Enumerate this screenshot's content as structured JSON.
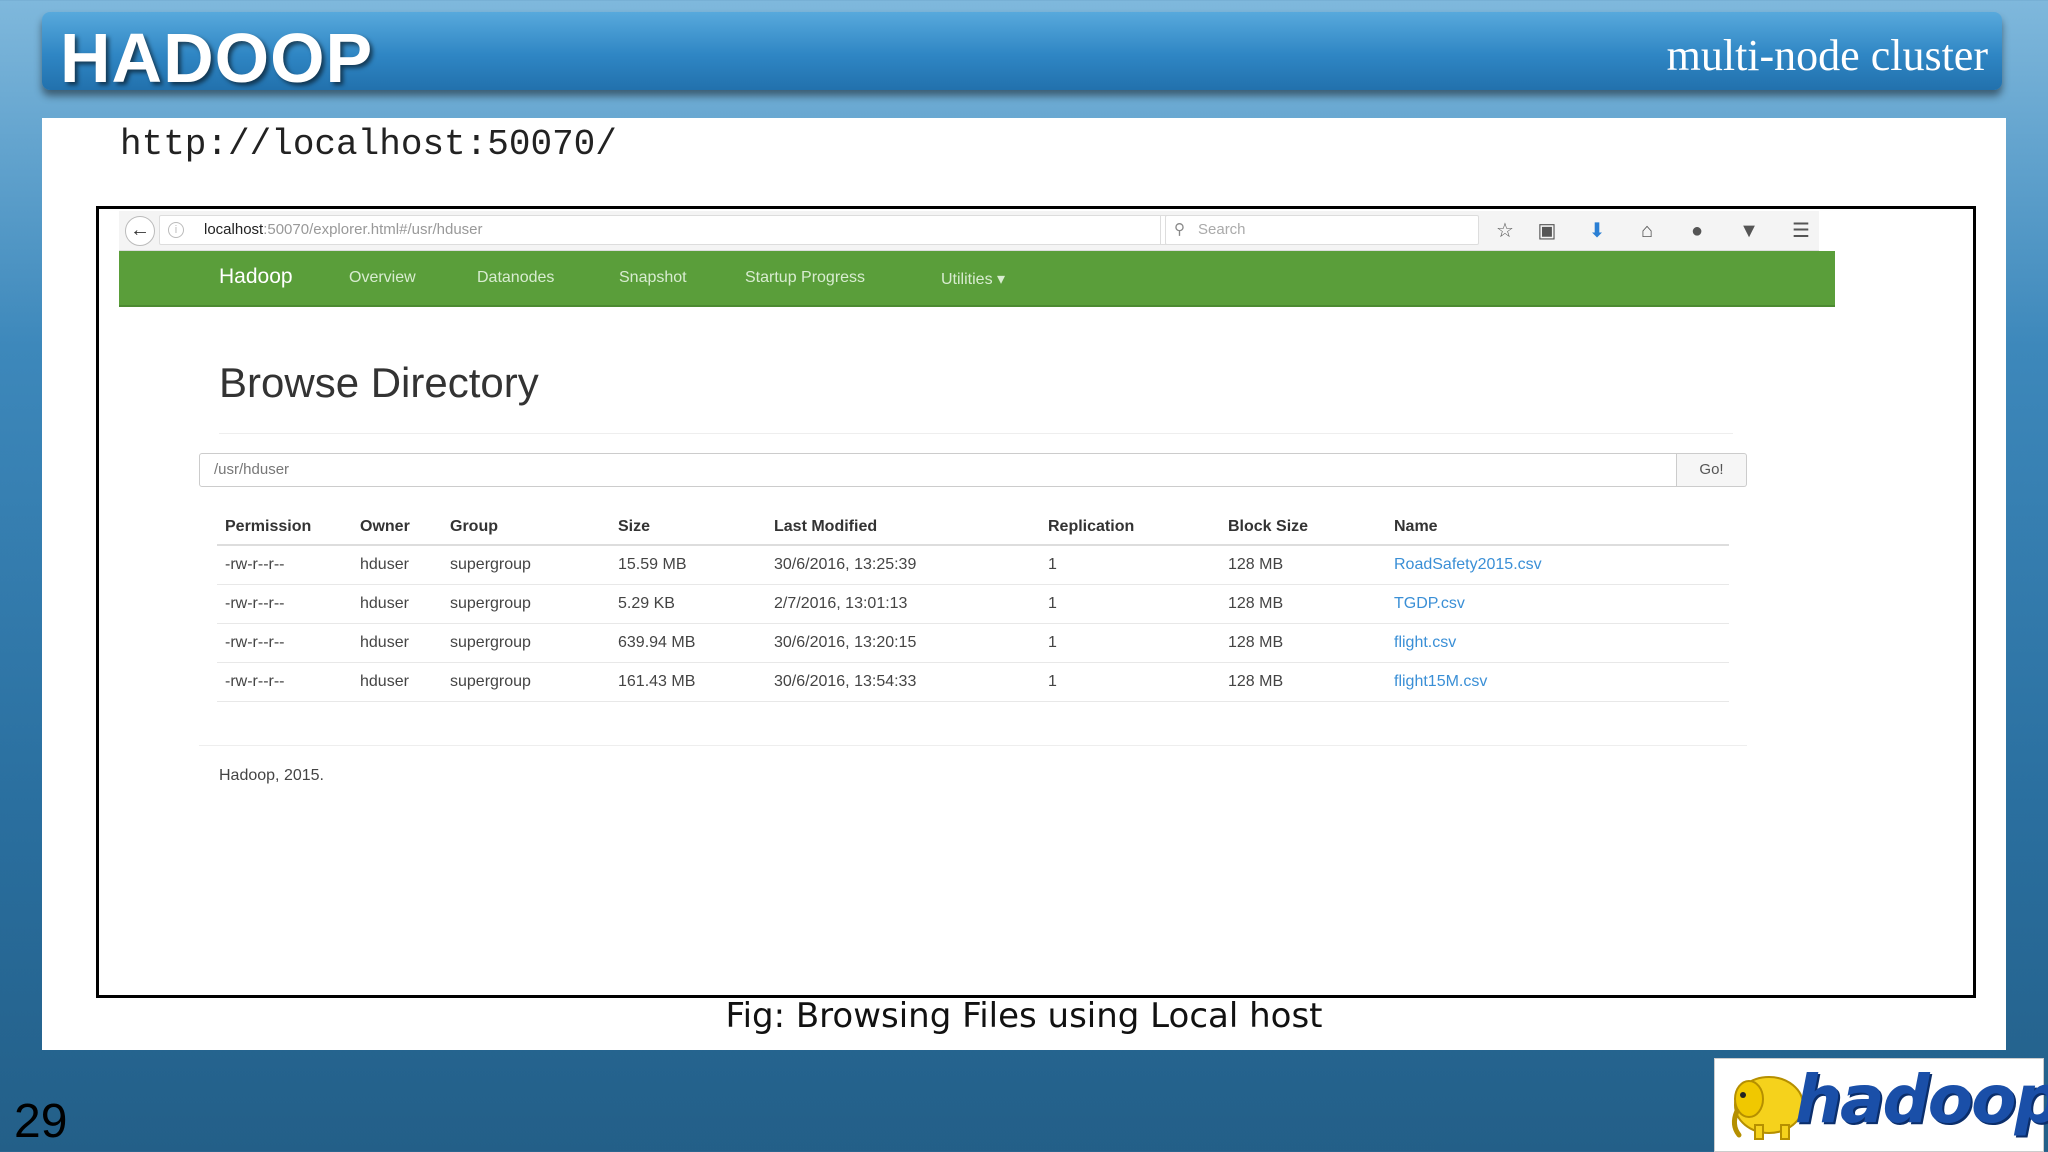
{
  "slide": {
    "title": "HADOOP",
    "subtitle": "multi-node cluster",
    "url_text": "http://localhost:50070/",
    "caption": "Fig: Browsing Files using Local host",
    "page_number": "29",
    "logo_text": "hadoop"
  },
  "browser": {
    "address_host": "localhost",
    "address_rest": ":50070/explorer.html#/usr/hduser",
    "search_placeholder": "Search",
    "icons": [
      "back-arrow-icon",
      "info-icon",
      "reload-icon",
      "search-icon",
      "star-icon",
      "camera-icon",
      "download-icon",
      "home-icon",
      "chat-icon",
      "pocket-icon",
      "menu-icon"
    ]
  },
  "navbar": {
    "brand": "Hadoop",
    "items": [
      "Overview",
      "Datanodes",
      "Snapshot",
      "Startup Progress",
      "Utilities ▾"
    ],
    "color": "#5a9e3a"
  },
  "page": {
    "heading": "Browse Directory",
    "path_value": "/usr/hduser",
    "go_label": "Go!",
    "footer": "Hadoop, 2015."
  },
  "table": {
    "headers": [
      "Permission",
      "Owner",
      "Group",
      "Size",
      "Last Modified",
      "Replication",
      "Block Size",
      "Name"
    ],
    "rows": [
      [
        "-rw-r--r--",
        "hduser",
        "supergroup",
        "15.59 MB",
        "30/6/2016, 13:25:39",
        "1",
        "128 MB",
        "RoadSafety2015.csv"
      ],
      [
        "-rw-r--r--",
        "hduser",
        "supergroup",
        "5.29 KB",
        "2/7/2016, 13:01:13",
        "1",
        "128 MB",
        "TGDP.csv"
      ],
      [
        "-rw-r--r--",
        "hduser",
        "supergroup",
        "639.94 MB",
        "30/6/2016, 13:20:15",
        "1",
        "128 MB",
        "flight.csv"
      ],
      [
        "-rw-r--r--",
        "hduser",
        "supergroup",
        "161.43 MB",
        "30/6/2016, 13:54:33",
        "1",
        "128 MB",
        "flight15M.csv"
      ]
    ]
  }
}
